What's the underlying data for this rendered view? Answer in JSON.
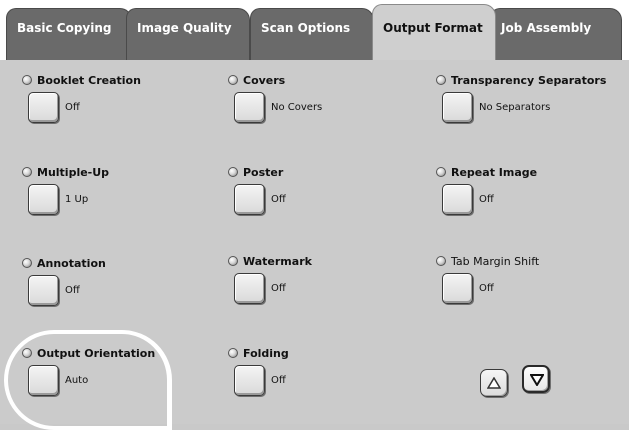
{
  "tabs": [
    {
      "label": "Basic Copying",
      "active": false
    },
    {
      "label": "Image Quality",
      "active": false
    },
    {
      "label": "Scan Options",
      "active": false
    },
    {
      "label": "Output Format",
      "active": true
    },
    {
      "label": "Job Assembly",
      "active": false
    }
  ],
  "features": {
    "booklet": {
      "title": "Booklet Creation",
      "value": "Off"
    },
    "covers": {
      "title": "Covers",
      "value": "No Covers"
    },
    "transparency": {
      "title": "Transparency Separators",
      "value": "No Separators"
    },
    "multiple_up": {
      "title": "Multiple-Up",
      "value": "1 Up"
    },
    "poster": {
      "title": "Poster",
      "value": "Off"
    },
    "repeat_image": {
      "title": "Repeat Image",
      "value": "Off"
    },
    "annotation": {
      "title": "Annotation",
      "value": "Off"
    },
    "watermark": {
      "title": "Watermark",
      "value": "Off"
    },
    "tab_margin_shift": {
      "title": "Tab Margin Shift",
      "value": "Off"
    },
    "output_orientation": {
      "title": "Output Orientation",
      "value": "Auto"
    },
    "folding": {
      "title": "Folding",
      "value": "Off"
    }
  },
  "icons": {
    "scroll_up": "triangle-up-icon",
    "scroll_down": "triangle-down-icon"
  },
  "colors": {
    "tab_inactive": "#6a6a6a",
    "panel": "#cbcbcb",
    "highlight_ring": "#ffffff"
  }
}
